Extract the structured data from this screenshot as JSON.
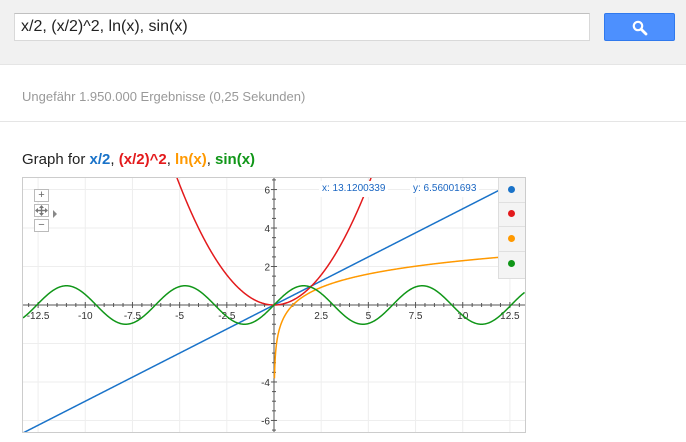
{
  "search": {
    "query": "x/2, (x/2)^2, ln(x), sin(x)",
    "button_icon": "magnifier-icon"
  },
  "results": {
    "stats": "Ungefähr 1.950.000 Ergebnisse (0,25 Sekunden)"
  },
  "graph": {
    "heading_prefix": "Graph for ",
    "separator": ", ",
    "coord_x": "x: 13.1200339",
    "coord_y": "y: 6.56001693",
    "nav": {
      "zoom_in": "+",
      "zoom_out": "−",
      "pan": "pan-icon",
      "expand": "chevron-right-icon"
    }
  },
  "chart_data": {
    "type": "line",
    "title": "Graph for x/2, (x/2)^2, ln(x), sin(x)",
    "xlim": [
      -13.3,
      13.3
    ],
    "ylim": [
      -6.6,
      6.6
    ],
    "x_ticks": [
      -12.5,
      -10,
      -7.5,
      -5,
      -2.5,
      2.5,
      5,
      7.5,
      10,
      12.5
    ],
    "x_tick_labels": [
      "-12.5",
      "-10",
      "-7.5",
      "-5",
      "-2.5",
      "2.5",
      "5",
      "7.5",
      "10",
      "12.5"
    ],
    "y_ticks": [
      6,
      4,
      2,
      -4,
      -6
    ],
    "y_tick_labels": [
      "6",
      "4",
      "2",
      "-4",
      "-6"
    ],
    "grid": true,
    "legend": "right",
    "series": [
      {
        "name": "x/2",
        "color": "#1a73c9",
        "function": "x/2"
      },
      {
        "name": "(x/2)^2",
        "color": "#e31a1c",
        "function": "(x/2)^2"
      },
      {
        "name": "ln(x)",
        "color": "#ff9900",
        "function": "ln(x)"
      },
      {
        "name": "sin(x)",
        "color": "#109618",
        "function": "sin(x)"
      }
    ],
    "cursor": {
      "x": 13.1200339,
      "y": 6.56001693
    }
  }
}
